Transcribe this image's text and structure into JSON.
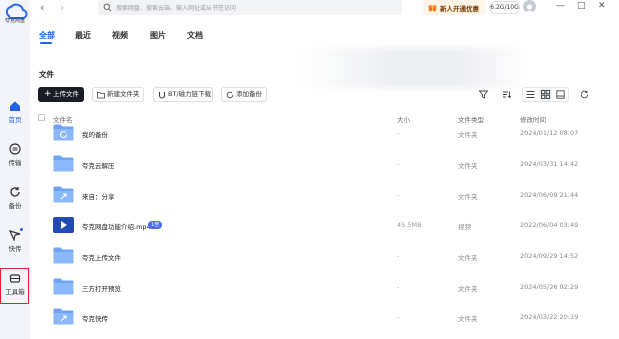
{
  "app": {
    "name": "夸克网盘"
  },
  "rail": {
    "items": [
      {
        "label": "首页",
        "icon": "home-icon"
      },
      {
        "label": "传输",
        "icon": "transfer-icon"
      },
      {
        "label": "备份",
        "icon": "backup-icon"
      },
      {
        "label": "快传",
        "icon": "quick-share-icon"
      },
      {
        "label": "工具箱",
        "icon": "toolbox-icon"
      }
    ]
  },
  "topbar": {
    "search_placeholder": "搜索网盘、搜索云端、输入网址或从书签访问",
    "promo": "新人开通优惠",
    "storage": "6.2G/10G",
    "window": {
      "minimize": "—",
      "maximize": "□",
      "close": "✕"
    }
  },
  "tabs": [
    "全部",
    "最近",
    "视频",
    "图片",
    "文档"
  ],
  "section_title": "文件",
  "actions": {
    "upload": "上传文件",
    "new_folder": "新建文件夹",
    "bt_download": "BT/磁力链下载",
    "add_backup": "添加备份"
  },
  "table": {
    "headers": {
      "name": "文件名",
      "size": "大小",
      "type": "文件类型",
      "modified": "修改时间"
    },
    "rows": [
      {
        "name": "我的备份",
        "size": "-",
        "type": "文件夹",
        "modified": "2024/01/12 08:07",
        "kind": "folder-backup"
      },
      {
        "name": "夸克云解压",
        "size": "-",
        "type": "文件夹",
        "modified": "2024/03/31 14:42",
        "kind": "folder"
      },
      {
        "name": "来自：分享",
        "size": "-",
        "type": "文件夹",
        "modified": "2024/06/09 21:44",
        "kind": "folder-share"
      },
      {
        "name": "夸克网盘功能介绍.mp4",
        "size": "45.5MB",
        "type": "视频",
        "modified": "2022/06/04 03:49",
        "kind": "video",
        "badge": "1倍"
      },
      {
        "name": "夸克上传文件",
        "size": "-",
        "type": "文件夹",
        "modified": "2024/09/29 14:52",
        "kind": "folder"
      },
      {
        "name": "三方打开预览",
        "size": "-",
        "type": "文件夹",
        "modified": "2024/05/26 02:29",
        "kind": "folder"
      },
      {
        "name": "夸克快传",
        "size": "-",
        "type": "文件夹",
        "modified": "2024/03/22 20:19",
        "kind": "folder-share"
      }
    ]
  },
  "colors": {
    "accent": "#1e63e9",
    "folder": "#6fa3f5",
    "highlight_box": "#e0202a",
    "upload_button": "#1a1d24"
  }
}
